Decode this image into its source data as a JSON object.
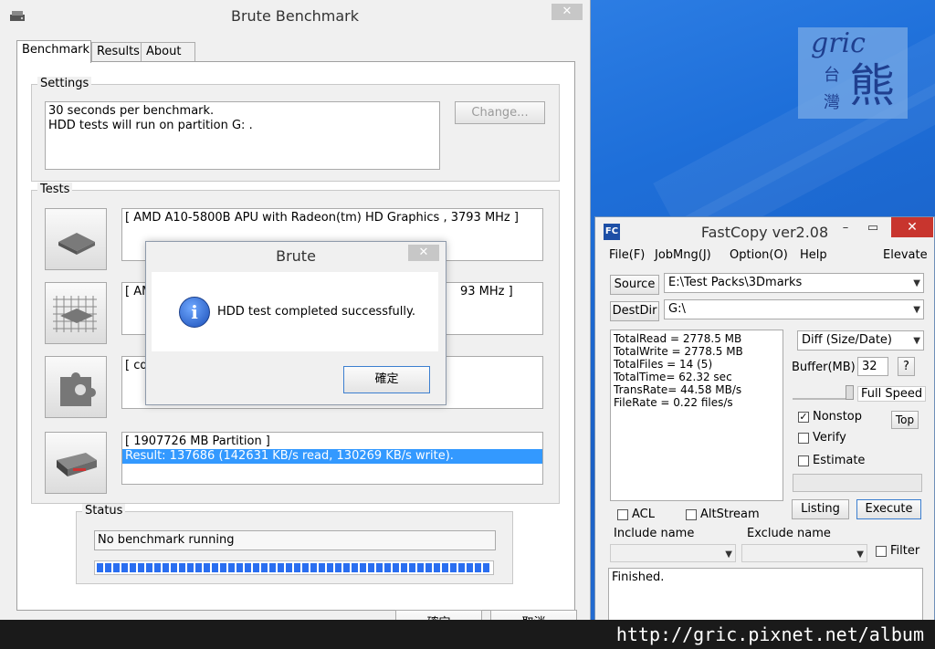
{
  "brute": {
    "title": "Brute Benchmark",
    "tabs": [
      "Benchmark",
      "Results",
      "About"
    ],
    "settings": {
      "label": "Settings",
      "lines": [
        "30 seconds per benchmark.",
        "HDD tests will run on partition G: ."
      ],
      "change_button": "Change..."
    },
    "tests": {
      "label": "Tests",
      "cpu_text": "[ AMD A10-5800B APU with Radeon(tm) HD Graphics  , 3793 MHz ]",
      "mem_text_left": "[ AM",
      "mem_text_right": "93 MHz ]",
      "gfx_text": "[ cd",
      "hdd_line1": "[ 1907726 MB Partition ]",
      "hdd_line2": "Result: 137686 (142631 KB/s read, 130269 KB/s  write)."
    },
    "status": {
      "label": "Status",
      "text": "No benchmark running",
      "progress": 1.0
    },
    "ok_button": "確定",
    "cancel_button": "取消"
  },
  "dialog": {
    "title": "Brute",
    "close": "✕",
    "message": "HDD test completed successfully.",
    "ok_button": "確定",
    "icon": "info-icon"
  },
  "fastcopy": {
    "title": "FastCopy ver2.08",
    "menu": [
      "File(F)",
      "JobMng(J)",
      "Option(O)",
      "Help",
      "Elevate"
    ],
    "source_label": "Source",
    "source_value": "E:\\Test Packs\\3Dmarks",
    "destdir_label": "DestDir",
    "destdir_value": "G:\\",
    "stats": [
      "TotalRead = 2778.5 MB",
      "TotalWrite = 2778.5 MB",
      "TotalFiles = 14 (5)",
      "TotalTime= 62.32 sec",
      "TransRate= 44.58 MB/s",
      "FileRate  = 0.22 files/s"
    ],
    "mode": "Diff (Size/Date)",
    "buffer_label": "Buffer(MB)",
    "buffer_value": "32",
    "help_button": "?",
    "speed_label": "Full Speed",
    "nonstop_label": "Nonstop",
    "nonstop_checked": true,
    "top_button": "Top",
    "verify_label": "Verify",
    "estimate_label": "Estimate",
    "acl_label": "ACL",
    "altstream_label": "AltStream",
    "listing_button": "Listing",
    "execute_button": "Execute",
    "include_label": "Include name",
    "exclude_label": "Exclude name",
    "filter_label": "Filter",
    "log_text": "Finished."
  },
  "logo": {
    "line1": "gric",
    "line2a": "台",
    "line2b": "灣",
    "line3": "熊"
  },
  "watermark": "http://gric.pixnet.net/album"
}
